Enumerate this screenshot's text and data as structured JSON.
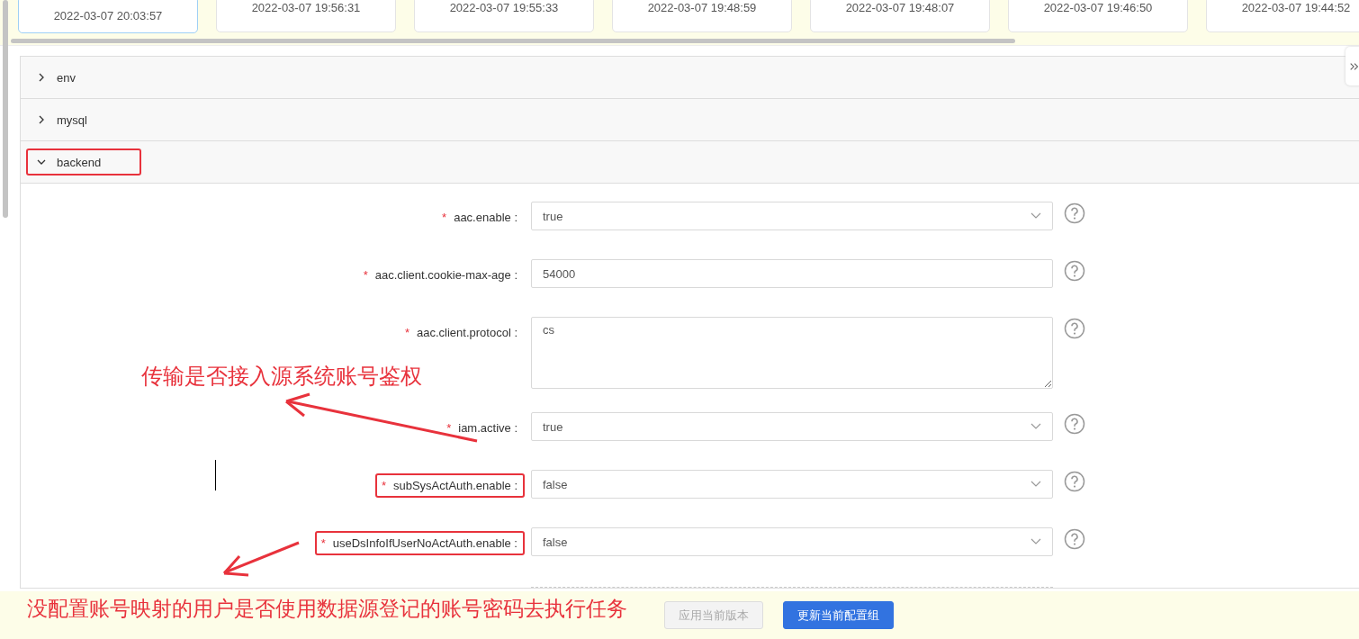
{
  "version_cards": [
    {
      "time": "2022-03-07 20:03:57",
      "selected": true
    },
    {
      "time": "2022-03-07 19:56:31",
      "selected": false
    },
    {
      "time": "2022-03-07 19:55:33",
      "selected": false
    },
    {
      "time": "2022-03-07 19:48:59",
      "selected": false
    },
    {
      "time": "2022-03-07 19:48:07",
      "selected": false
    },
    {
      "time": "2022-03-07 19:46:50",
      "selected": false
    },
    {
      "time": "2022-03-07 19:44:52",
      "selected": false
    }
  ],
  "sections": [
    {
      "title": "env",
      "expanded": false,
      "highlighted": false
    },
    {
      "title": "mysql",
      "expanded": false,
      "highlighted": false
    },
    {
      "title": "backend",
      "expanded": true,
      "highlighted": true
    }
  ],
  "fields": [
    {
      "label": "aac.enable :",
      "required_mark": "*",
      "kind": "select",
      "value": "true",
      "highlighted": false
    },
    {
      "label": "aac.client.cookie-max-age :",
      "required_mark": "*",
      "kind": "input",
      "value": "54000",
      "highlighted": false
    },
    {
      "label": "aac.client.protocol :",
      "required_mark": "*",
      "kind": "textarea",
      "value": "cs",
      "highlighted": false
    },
    {
      "label": "iam.active :",
      "required_mark": "*",
      "kind": "select",
      "value": "true",
      "highlighted": false
    },
    {
      "label": "subSysActAuth.enable :",
      "required_mark": "*",
      "kind": "select",
      "value": "false",
      "highlighted": true
    },
    {
      "label": "useDsInfoIfUserNoActAuth.enable :",
      "required_mark": "*",
      "kind": "select",
      "value": "false",
      "highlighted": true
    }
  ],
  "annotations": [
    {
      "text": "传输是否接入源系统账号鉴权"
    },
    {
      "text": "没配置账号映射的用户是否使用数据源登记的账号密码去执行任务"
    }
  ],
  "buttons": [
    {
      "label": "应用当前版本",
      "disabled": true,
      "kind": "default"
    },
    {
      "label": "更新当前配置组",
      "disabled": false,
      "kind": "primary"
    }
  ]
}
